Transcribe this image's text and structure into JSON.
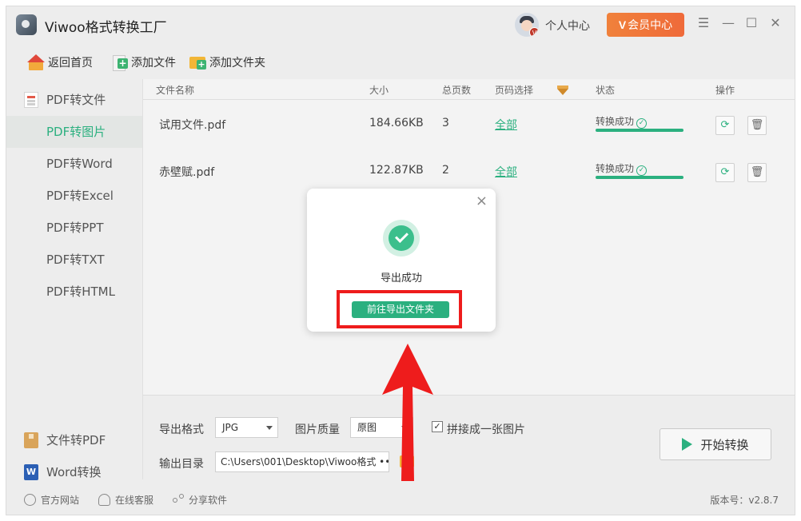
{
  "app": {
    "title": "Viwoo格式转换工厂"
  },
  "header": {
    "user_center": "个人中心",
    "vip_label": "会员中心",
    "vip_mark": "V",
    "avatar_badge": "V"
  },
  "window_controls": {
    "menu": "☰",
    "minimize": "—",
    "maximize": "☐",
    "close": "✕"
  },
  "toolbar": {
    "home": "返回首页",
    "add_file": "添加文件",
    "add_folder": "添加文件夹"
  },
  "sidebar": {
    "items": [
      {
        "label": "PDF转文件"
      },
      {
        "label": "PDF转图片"
      },
      {
        "label": "PDF转Word"
      },
      {
        "label": "PDF转Excel"
      },
      {
        "label": "PDF转PPT"
      },
      {
        "label": "PDF转TXT"
      },
      {
        "label": "PDF转HTML"
      }
    ],
    "bottom_items": [
      {
        "label": "文件转PDF"
      },
      {
        "label": "Word转换"
      }
    ]
  },
  "table": {
    "headers": {
      "name": "文件名称",
      "size": "大小",
      "pages": "总页数",
      "range": "页码选择",
      "status": "状态",
      "actions": "操作"
    },
    "rows": [
      {
        "name": "试用文件.pdf",
        "size": "184.66KB",
        "pages": "3",
        "range": "全部",
        "status": "转换成功",
        "progress": 1.0
      },
      {
        "name": "赤壁赋.pdf",
        "size": "122.87KB",
        "pages": "2",
        "range": "全部",
        "status": "转换成功",
        "progress": 1.0
      }
    ]
  },
  "settings": {
    "format_label": "导出格式",
    "format_value": "JPG",
    "quality_label": "图片质量",
    "quality_value": "原图",
    "merge_label": "拼接成一张图片",
    "merge_checked": true,
    "output_label": "输出目录",
    "output_path": "C:\\Users\\001\\Desktop\\Viwoo格式 •••",
    "start_label": "开始转换"
  },
  "statusbar": {
    "website": "官方网站",
    "support": "在线客服",
    "share": "分享软件",
    "version": "版本号：v2.8.7"
  },
  "modal": {
    "message": "导出成功",
    "button": "前往导出文件夹",
    "close": "×"
  },
  "colors": {
    "accent": "#2bb07f",
    "vip": "#ef6a3a",
    "annotation": "#ee1c1c"
  }
}
